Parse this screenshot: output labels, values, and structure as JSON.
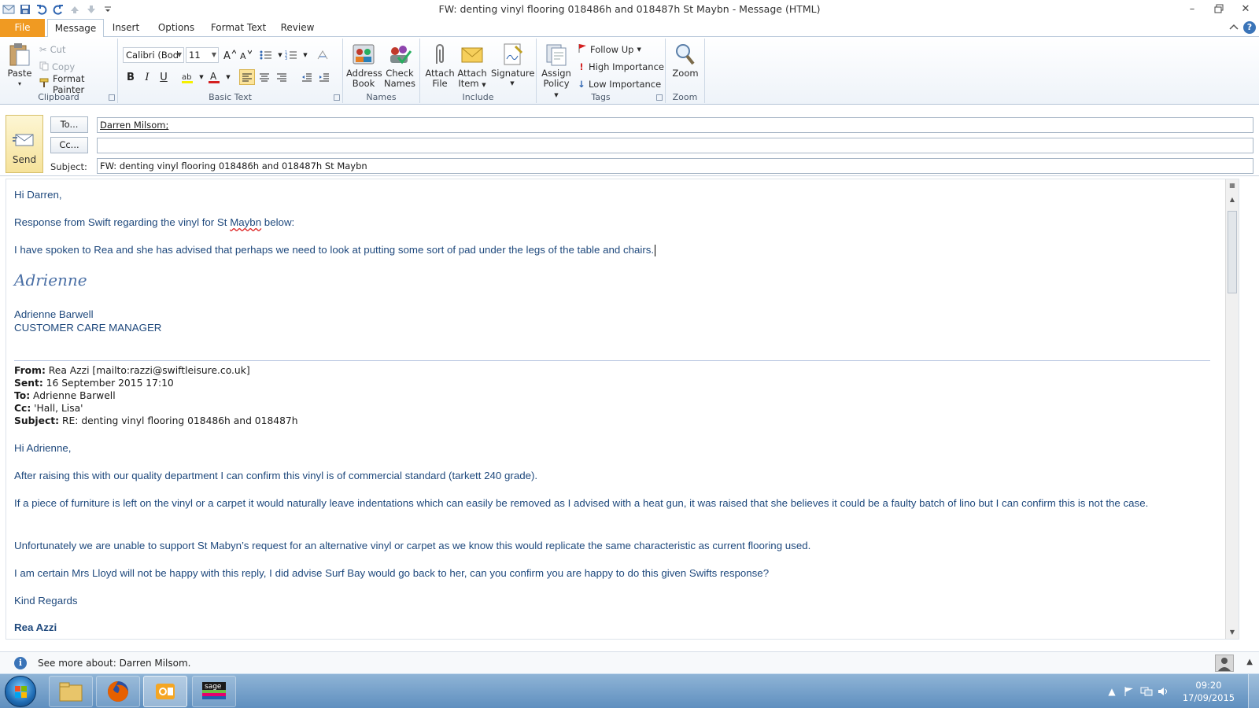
{
  "window": {
    "title": "FW: denting vinyl flooring 018486h and 018487h St Maybn  -  Message (HTML)",
    "controls": [
      "minimize-icon",
      "restore-icon",
      "close-icon"
    ]
  },
  "tabs": [
    "File",
    "Message",
    "Insert",
    "Options",
    "Format Text",
    "Review"
  ],
  "ribbon": {
    "clipboard": {
      "label": "Clipboard",
      "paste": "Paste",
      "cut": "Cut",
      "copy": "Copy",
      "format_painter": "Format Painter"
    },
    "basic_text": {
      "label": "Basic Text",
      "font": "Calibri (Bod",
      "size": "11"
    },
    "names": {
      "label": "Names",
      "address_book_1": "Address",
      "address_book_2": "Book",
      "check_names_1": "Check",
      "check_names_2": "Names"
    },
    "include": {
      "label": "Include",
      "attach_file_1": "Attach",
      "attach_file_2": "File",
      "attach_item_1": "Attach",
      "attach_item_2": "Item",
      "signature": "Signature"
    },
    "tags": {
      "label": "Tags",
      "assign_policy_1": "Assign",
      "assign_policy_2": "Policy",
      "follow_up": "Follow Up",
      "high_importance": "High Importance",
      "low_importance": "Low Importance"
    },
    "zoom": {
      "label": "Zoom",
      "zoom": "Zoom"
    }
  },
  "header": {
    "send": "Send",
    "to_button": "To...",
    "cc_button": "Cc...",
    "subject_label": "Subject:",
    "to_value": "Darren Milsom;",
    "cc_value": "",
    "subject_value": "FW: denting vinyl flooring 018486h and 018487h St Maybn"
  },
  "body": {
    "greeting": "Hi Darren,",
    "line1_pre": "Response from Swift regarding the vinyl for St ",
    "line1_word": "Maybn",
    "line1_post": " below:",
    "line2": "I have spoken to Rea and she has advised that perhaps we need to look at putting some sort of pad under the legs of the table and chairs.",
    "signature_script": "Adrienne",
    "sig_name": "Adrienne Barwell",
    "sig_title": "CUSTOMER CARE MANAGER",
    "fwd": {
      "from_label": "From:",
      "from": " Rea Azzi [mailto:razzi@swiftleisure.co.uk]",
      "sent_label": "Sent:",
      "sent": " 16 September 2015 17:10",
      "to_label": "To:",
      "to": " Adrienne Barwell",
      "cc_label": "Cc:",
      "cc": " 'Hall, Lisa'",
      "subject_label": "Subject:",
      "subject": " RE: denting vinyl flooring 018486h and 018487h"
    },
    "fwd_greeting": "Hi Adrienne,",
    "p1": "After raising this with our quality department I can confirm this vinyl is of commercial standard (tarkett 240 grade).",
    "p2": "If a piece of furniture is left on the vinyl or a carpet it would naturally leave indentations which can easily be removed as I advised with a heat gun, it was raised that she believes it could be a faulty batch of lino but I can confirm this is not the case.",
    "p3": "Unfortunately we are unable to support St Mabyn’s request for an alternative vinyl or carpet as we know this would replicate the same characteristic as current flooring used.",
    "p4": "I am certain Mrs Lloyd will not  be happy with this reply, I did advise Surf Bay would go back to her, can you confirm you are happy to do this given Swifts response?",
    "closing": "Kind Regards",
    "sender_cut": "Rea Azzi"
  },
  "people_bar": {
    "text": "See more about: Darren Milsom."
  },
  "taskbar": {
    "apps": [
      "explorer-icon",
      "firefox-icon",
      "outlook-icon",
      "sage-icon"
    ],
    "time": "09:20",
    "date": "17/09/2015"
  },
  "colors": {
    "file_tab": "#f09a22",
    "body_text": "#1f497d",
    "taskbar": "#6f9cc8"
  }
}
